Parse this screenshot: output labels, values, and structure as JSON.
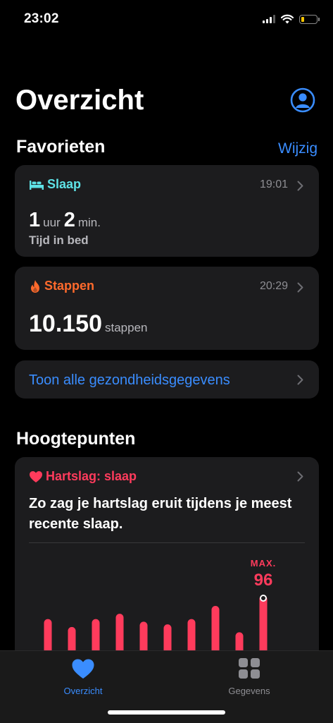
{
  "status_bar": {
    "time": "23:02",
    "battery_level": 0.2,
    "battery_color": "#f5c400"
  },
  "header": {
    "title": "Overzicht",
    "profile_icon": "person-circle-icon"
  },
  "favorites": {
    "title": "Favorieten",
    "edit_label": "Wijzig",
    "sleep": {
      "label": "Slaap",
      "icon": "bed-icon",
      "color": "#5ee2e6",
      "time": "19:01",
      "hours": "1",
      "hours_unit": "uur",
      "minutes": "2",
      "minutes_unit": "min.",
      "sub": "Tijd in bed"
    },
    "steps": {
      "label": "Stappen",
      "icon": "flame-icon",
      "color": "#ff6a2c",
      "time": "20:29",
      "value": "10.150",
      "unit": "stappen"
    },
    "show_all_label": "Toon alle gezondheidsgegevens"
  },
  "highlights": {
    "title": "Hoogtepunten",
    "heart": {
      "label": "Hartslag: slaap",
      "icon": "heart-icon",
      "color": "#ff3b5c",
      "description": "Zo zag je hartslag eruit tijdens je meest recente slaap.",
      "max_label": "MAX.",
      "max_value": "96"
    }
  },
  "chart_data": {
    "type": "bar",
    "series": [
      {
        "values": [
          78,
          72,
          78,
          82,
          76,
          74,
          78,
          88,
          68,
          96
        ]
      }
    ],
    "color": "#ff3b5c",
    "max_label": "MAX.",
    "max_value": 96
  },
  "tabbar": {
    "tabs": [
      {
        "label": "Overzicht",
        "icon": "heart-icon",
        "active": true,
        "color": "#3a8dff"
      },
      {
        "label": "Gegevens",
        "icon": "grid-icon",
        "active": false,
        "color": "#8e8e93"
      }
    ]
  }
}
